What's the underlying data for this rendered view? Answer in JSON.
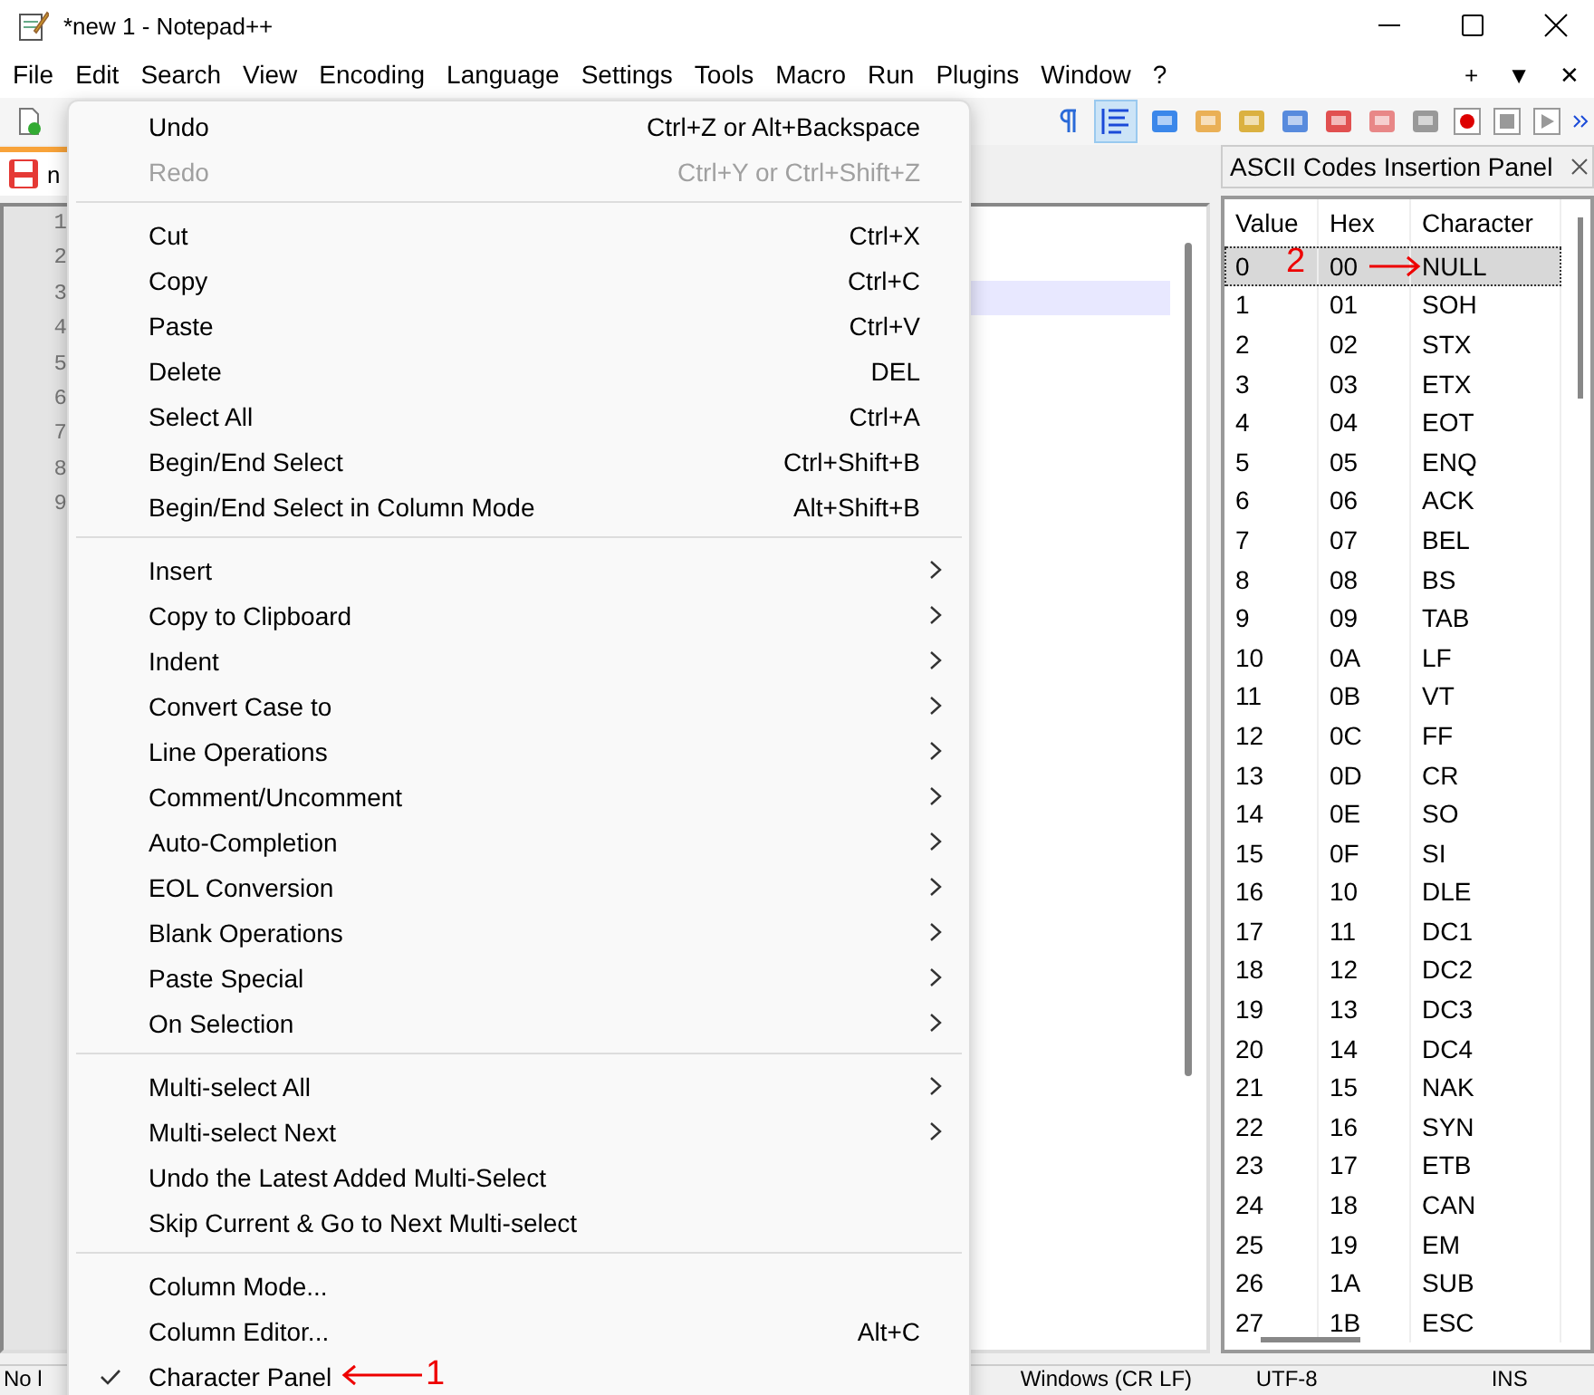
{
  "window": {
    "title": "*new 1 - Notepad++"
  },
  "menubar": {
    "items": [
      "File",
      "Edit",
      "Search",
      "View",
      "Encoding",
      "Language",
      "Settings",
      "Tools",
      "Macro",
      "Run",
      "Plugins",
      "Window",
      "?"
    ],
    "right": [
      "+",
      "▼",
      "✕"
    ]
  },
  "tab": {
    "label": "n"
  },
  "editor": {
    "lines": [
      {
        "number": "1",
        "current": false
      },
      {
        "number": "2",
        "current": false
      },
      {
        "number": "3",
        "current": true
      },
      {
        "number": "4",
        "current": false
      },
      {
        "number": "5",
        "current": false
      },
      {
        "number": "6",
        "current": false
      },
      {
        "number": "7",
        "current": false
      },
      {
        "number": "8",
        "current": false
      },
      {
        "number": "9",
        "current": false
      }
    ]
  },
  "edit_menu": [
    {
      "kind": "item",
      "label": "Undo",
      "shortcut": "Ctrl+Z or Alt+Backspace",
      "disabled": false,
      "checked": false,
      "submenu": false
    },
    {
      "kind": "item",
      "label": "Redo",
      "shortcut": "Ctrl+Y or Ctrl+Shift+Z",
      "disabled": true,
      "checked": false,
      "submenu": false
    },
    {
      "kind": "separator"
    },
    {
      "kind": "item",
      "label": "Cut",
      "shortcut": "Ctrl+X",
      "disabled": false,
      "checked": false,
      "submenu": false
    },
    {
      "kind": "item",
      "label": "Copy",
      "shortcut": "Ctrl+C",
      "disabled": false,
      "checked": false,
      "submenu": false
    },
    {
      "kind": "item",
      "label": "Paste",
      "shortcut": "Ctrl+V",
      "disabled": false,
      "checked": false,
      "submenu": false
    },
    {
      "kind": "item",
      "label": "Delete",
      "shortcut": "DEL",
      "disabled": false,
      "checked": false,
      "submenu": false
    },
    {
      "kind": "item",
      "label": "Select All",
      "shortcut": "Ctrl+A",
      "disabled": false,
      "checked": false,
      "submenu": false
    },
    {
      "kind": "item",
      "label": "Begin/End Select",
      "shortcut": "Ctrl+Shift+B",
      "disabled": false,
      "checked": false,
      "submenu": false
    },
    {
      "kind": "item",
      "label": "Begin/End Select in Column Mode",
      "shortcut": "Alt+Shift+B",
      "disabled": false,
      "checked": false,
      "submenu": false
    },
    {
      "kind": "separator"
    },
    {
      "kind": "item",
      "label": "Insert",
      "disabled": false,
      "checked": false,
      "submenu": true
    },
    {
      "kind": "item",
      "label": "Copy to Clipboard",
      "disabled": false,
      "checked": false,
      "submenu": true
    },
    {
      "kind": "item",
      "label": "Indent",
      "disabled": false,
      "checked": false,
      "submenu": true
    },
    {
      "kind": "item",
      "label": "Convert Case to",
      "disabled": false,
      "checked": false,
      "submenu": true
    },
    {
      "kind": "item",
      "label": "Line Operations",
      "disabled": false,
      "checked": false,
      "submenu": true
    },
    {
      "kind": "item",
      "label": "Comment/Uncomment",
      "disabled": false,
      "checked": false,
      "submenu": true
    },
    {
      "kind": "item",
      "label": "Auto-Completion",
      "disabled": false,
      "checked": false,
      "submenu": true
    },
    {
      "kind": "item",
      "label": "EOL Conversion",
      "disabled": false,
      "checked": false,
      "submenu": true
    },
    {
      "kind": "item",
      "label": "Blank Operations",
      "disabled": false,
      "checked": false,
      "submenu": true
    },
    {
      "kind": "item",
      "label": "Paste Special",
      "disabled": false,
      "checked": false,
      "submenu": true
    },
    {
      "kind": "item",
      "label": "On Selection",
      "disabled": false,
      "checked": false,
      "submenu": true
    },
    {
      "kind": "separator"
    },
    {
      "kind": "item",
      "label": "Multi-select All",
      "disabled": false,
      "checked": false,
      "submenu": true
    },
    {
      "kind": "item",
      "label": "Multi-select Next",
      "disabled": false,
      "checked": false,
      "submenu": true
    },
    {
      "kind": "item",
      "label": "Undo the Latest Added Multi-Select",
      "disabled": false,
      "checked": false,
      "submenu": false
    },
    {
      "kind": "item",
      "label": "Skip Current & Go to Next Multi-select",
      "disabled": false,
      "checked": false,
      "submenu": false
    },
    {
      "kind": "separator"
    },
    {
      "kind": "item",
      "label": "Column Mode...",
      "disabled": false,
      "checked": false,
      "submenu": false
    },
    {
      "kind": "item",
      "label": "Column Editor...",
      "shortcut": "Alt+C",
      "disabled": false,
      "checked": false,
      "submenu": false
    },
    {
      "kind": "item",
      "label": "Character Panel",
      "disabled": false,
      "checked": true,
      "submenu": false
    }
  ],
  "ascii_panel": {
    "title": "ASCII Codes Insertion Panel",
    "columns": [
      "Value",
      "Hex",
      "Character"
    ],
    "rows": [
      {
        "value": "0",
        "hex": "00",
        "character": "NULL",
        "selected": true
      },
      {
        "value": "1",
        "hex": "01",
        "character": "SOH",
        "selected": false
      },
      {
        "value": "2",
        "hex": "02",
        "character": "STX",
        "selected": false
      },
      {
        "value": "3",
        "hex": "03",
        "character": "ETX",
        "selected": false
      },
      {
        "value": "4",
        "hex": "04",
        "character": "EOT",
        "selected": false
      },
      {
        "value": "5",
        "hex": "05",
        "character": "ENQ",
        "selected": false
      },
      {
        "value": "6",
        "hex": "06",
        "character": "ACK",
        "selected": false
      },
      {
        "value": "7",
        "hex": "07",
        "character": "BEL",
        "selected": false
      },
      {
        "value": "8",
        "hex": "08",
        "character": "BS",
        "selected": false
      },
      {
        "value": "9",
        "hex": "09",
        "character": "TAB",
        "selected": false
      },
      {
        "value": "10",
        "hex": "0A",
        "character": "LF",
        "selected": false
      },
      {
        "value": "11",
        "hex": "0B",
        "character": "VT",
        "selected": false
      },
      {
        "value": "12",
        "hex": "0C",
        "character": "FF",
        "selected": false
      },
      {
        "value": "13",
        "hex": "0D",
        "character": "CR",
        "selected": false
      },
      {
        "value": "14",
        "hex": "0E",
        "character": "SO",
        "selected": false
      },
      {
        "value": "15",
        "hex": "0F",
        "character": "SI",
        "selected": false
      },
      {
        "value": "16",
        "hex": "10",
        "character": "DLE",
        "selected": false
      },
      {
        "value": "17",
        "hex": "11",
        "character": "DC1",
        "selected": false
      },
      {
        "value": "18",
        "hex": "12",
        "character": "DC2",
        "selected": false
      },
      {
        "value": "19",
        "hex": "13",
        "character": "DC3",
        "selected": false
      },
      {
        "value": "20",
        "hex": "14",
        "character": "DC4",
        "selected": false
      },
      {
        "value": "21",
        "hex": "15",
        "character": "NAK",
        "selected": false
      },
      {
        "value": "22",
        "hex": "16",
        "character": "SYN",
        "selected": false
      },
      {
        "value": "23",
        "hex": "17",
        "character": "ETB",
        "selected": false
      },
      {
        "value": "24",
        "hex": "18",
        "character": "CAN",
        "selected": false
      },
      {
        "value": "25",
        "hex": "19",
        "character": "EM",
        "selected": false
      },
      {
        "value": "26",
        "hex": "1A",
        "character": "SUB",
        "selected": false
      },
      {
        "value": "27",
        "hex": "1B",
        "character": "ESC",
        "selected": false
      }
    ]
  },
  "status_bar": [
    "No l",
    "Windows (CR LF)",
    "UTF-8",
    "INS"
  ],
  "annotations": [
    {
      "label": "1"
    },
    {
      "label": "2"
    }
  ]
}
